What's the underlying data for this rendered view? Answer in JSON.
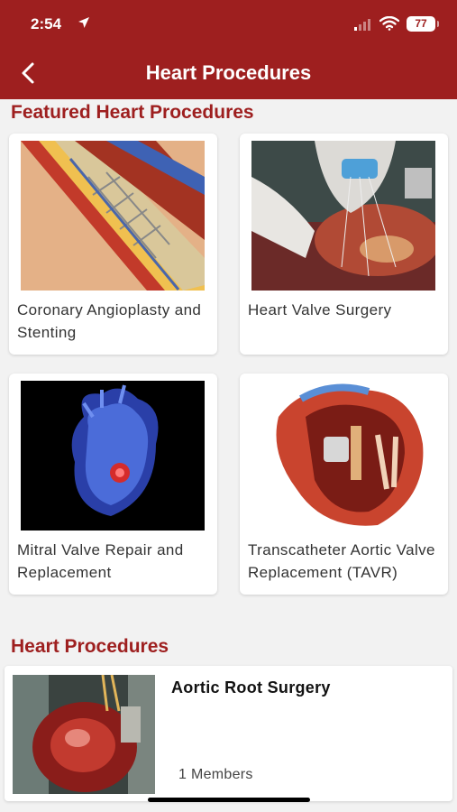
{
  "status_bar": {
    "time": "2:54",
    "battery": "77"
  },
  "header": {
    "title": "Heart Procedures",
    "back_icon": "chevron-left-icon"
  },
  "featured": {
    "heading": "Featured Heart Procedures",
    "items": [
      {
        "label": "Coronary Angioplasty and Stenting"
      },
      {
        "label": "Heart Valve Surgery"
      },
      {
        "label": "Mitral Valve Repair and Replacement"
      },
      {
        "label": "Transcatheter Aortic Valve Replacement (TAVR)"
      }
    ]
  },
  "procedures": {
    "heading": "Heart Procedures",
    "items": [
      {
        "title": "Aortic Root Surgery",
        "members": "1 Members"
      }
    ]
  },
  "colors": {
    "brand": "#9e1f1f",
    "background": "#f2f2f2"
  }
}
